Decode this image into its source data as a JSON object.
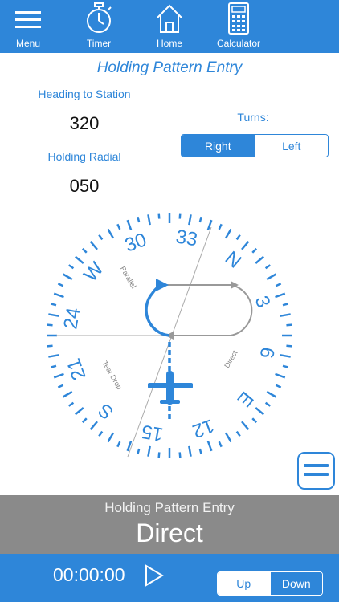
{
  "nav": {
    "menu": "Menu",
    "timer": "Timer",
    "home": "Home",
    "calculator": "Calculator"
  },
  "title": "Holding Pattern Entry",
  "heading": {
    "label": "Heading to Station",
    "value": "320"
  },
  "radial": {
    "label": "Holding Radial",
    "value": "050"
  },
  "turns": {
    "label": "Turns:",
    "right": "Right",
    "left": "Left",
    "selected": "Right"
  },
  "compass": {
    "labels": [
      "N",
      "3",
      "6",
      "E",
      "12",
      "15",
      "S",
      "21",
      "24",
      "W",
      "30",
      "33"
    ],
    "sectors": {
      "parallel": "Parallel",
      "teardrop": "Tear Drop",
      "direct": "Direct"
    },
    "accent": "#2e86d9"
  },
  "result": {
    "label": "Holding Pattern Entry",
    "value": "Direct"
  },
  "bottom": {
    "timer": "00:00:00",
    "up": "Up",
    "down": "Down"
  },
  "colors": {
    "accent": "#2e86d9",
    "result_bar": "#8a8a8a"
  }
}
